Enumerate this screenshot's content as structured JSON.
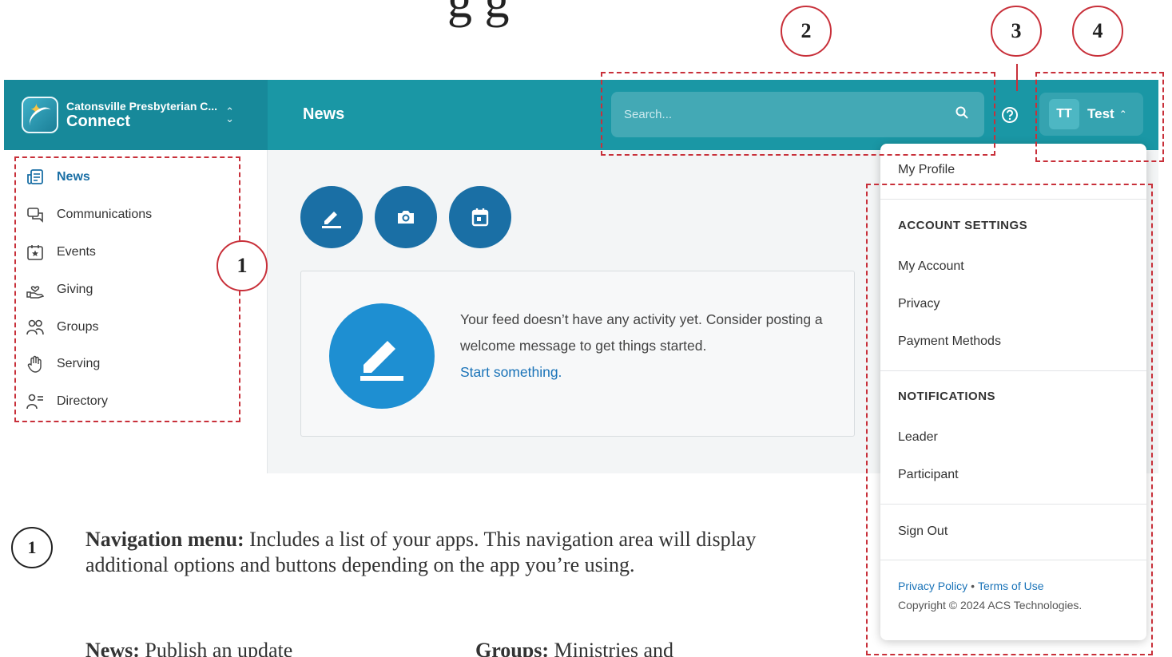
{
  "doc_title_fragment": "g g",
  "callouts": [
    "1",
    "2",
    "3",
    "4"
  ],
  "header": {
    "church_name": "Catonsville Presbyterian C...",
    "app_name": "Connect",
    "page_title": "News",
    "search_placeholder": "Search...",
    "user_initials": "TT",
    "user_name": "Test"
  },
  "sidebar": {
    "items": [
      {
        "label": "News",
        "icon": "news-icon"
      },
      {
        "label": "Communications",
        "icon": "chat-icon"
      },
      {
        "label": "Events",
        "icon": "calendar-star-icon"
      },
      {
        "label": "Giving",
        "icon": "hand-heart-icon"
      },
      {
        "label": "Groups",
        "icon": "people-icon"
      },
      {
        "label": "Serving",
        "icon": "hand-icon"
      },
      {
        "label": "Directory",
        "icon": "person-list-icon"
      }
    ]
  },
  "main": {
    "actions": [
      "pencil-icon",
      "camera-icon",
      "calendar-icon"
    ],
    "empty_text": "Your feed doesn’t have any activity yet. Consider posting a welcome message to get things started.",
    "empty_link": "Start something."
  },
  "dropdown": {
    "my_profile": "My Profile",
    "account_settings": "ACCOUNT SETTINGS",
    "my_account": "My Account",
    "privacy": "Privacy",
    "payment_methods": "Payment Methods",
    "notifications": "NOTIFICATIONS",
    "leader": "Leader",
    "participant": "Participant",
    "sign_out": "Sign Out",
    "privacy_policy": "Privacy Policy",
    "separator": "•",
    "terms": "Terms of Use",
    "copyright": "Copyright © 2024 ACS Technologies."
  },
  "description": {
    "num": "1",
    "term": "Navigation menu:",
    "text": " Includes a list of your apps. This navigation area will display additional options and buttons depending on the app you’re using.",
    "bottom_left_term": "News:",
    "bottom_left": " Publish an update",
    "bottom_right_term": "Groups:",
    "bottom_right": " Ministries and"
  },
  "colors": {
    "header_teal": "#1a97a5",
    "sidebar_teal": "#17899a",
    "accent_blue": "#1a6fa5",
    "callout_red": "#c8303a"
  }
}
